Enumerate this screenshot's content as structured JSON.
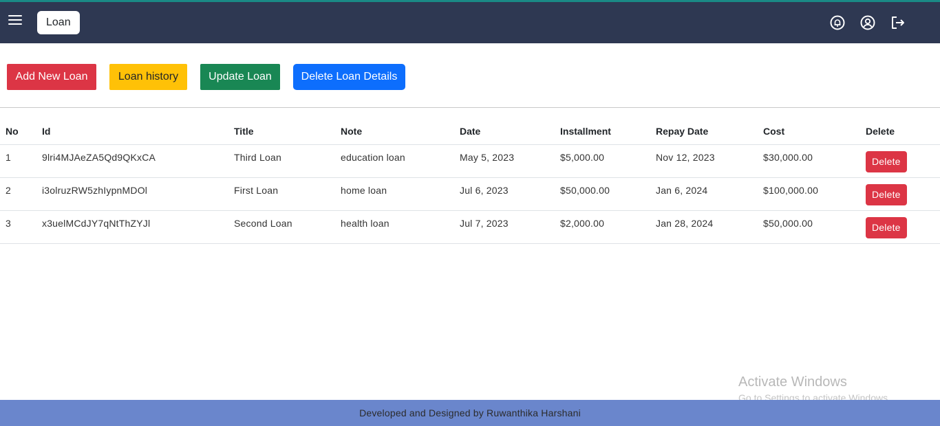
{
  "navbar": {
    "title": "Loan",
    "icons": [
      "menu-icon",
      "notification-icon",
      "user-profile-icon",
      "logout-icon"
    ]
  },
  "actions": {
    "add_label": "Add New Loan",
    "history_label": "Loan history",
    "update_label": "Update Loan",
    "delete_details_label": "Delete Loan Details"
  },
  "table": {
    "headers": {
      "no": "No",
      "id": "Id",
      "title": "Title",
      "note": "Note",
      "date": "Date",
      "installment": "Installment",
      "repay_date": "Repay Date",
      "cost": "Cost",
      "delete": "Delete"
    },
    "rows": [
      {
        "no": "1",
        "id": "9lri4MJAeZA5Qd9QKxCA",
        "title": "Third Loan",
        "note": "education loan",
        "date": "May 5, 2023",
        "installment": "$5,000.00",
        "repay_date": "Nov 12, 2023",
        "cost": "$30,000.00",
        "delete_label": "Delete"
      },
      {
        "no": "2",
        "id": "i3olruzRW5zhIypnMDOl",
        "title": "First Loan",
        "note": "home loan",
        "date": "Jul 6, 2023",
        "installment": "$50,000.00",
        "repay_date": "Jan 6, 2024",
        "cost": "$100,000.00",
        "delete_label": "Delete"
      },
      {
        "no": "3",
        "id": "x3uelMCdJY7qNtThZYJl",
        "title": "Second Loan",
        "note": "health loan",
        "date": "Jul 7, 2023",
        "installment": "$2,000.00",
        "repay_date": "Jan 28, 2024",
        "cost": "$50,000.00",
        "delete_label": "Delete"
      }
    ]
  },
  "watermark": {
    "line1": "Activate Windows",
    "line2": "Go to Settings to activate Windows."
  },
  "footer": {
    "text": "Developed and Designed by Ruwanthika Harshani"
  },
  "colors": {
    "navbar": "#2e3852",
    "danger": "#dc3545",
    "warning": "#ffc107",
    "success": "#198754",
    "primary": "#0d6efd",
    "footer": "#6a86cc"
  }
}
